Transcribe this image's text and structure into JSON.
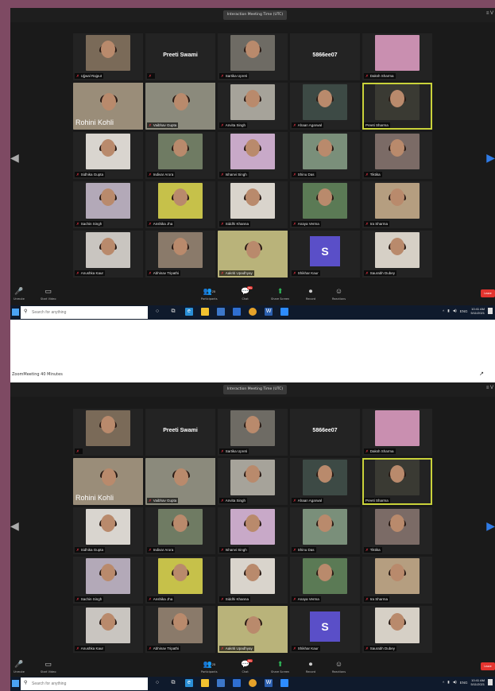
{
  "meeting_title": "Interaction Meeting Time (UTC)",
  "view_label": "≡ V",
  "gap_caption": "ZoomMeeting 40 Minutes",
  "gap_mark": "↗",
  "participants": {
    "r1c1": "Ujjwal Rajput",
    "r1c2": "Preeti Swami",
    "r1c3": "Sartika Upreti",
    "r1c4": "5866ee07",
    "r1c5": "Daksh Sharma",
    "r2c1": "Rohini Kohli",
    "r2c2": "Vaibhav Gupta",
    "r2c3": "Anvita Singh",
    "r2c4": "Ahaan Agarwal",
    "r2c5": "Preeti Sharma",
    "r3c1": "Sidhika Gupta",
    "r3c2": "Indivar Arora",
    "r3c3": "Ishanvi Singh",
    "r3c4": "Shinu Das",
    "r3c5": "Tiktika",
    "r4c1": "Sachin Singh",
    "r4c2": "Anshika Jha",
    "r4c3": "Siddhi Khanna",
    "r4c4": "Anaya Verma",
    "r4c5": "Ira Sharma",
    "r5c1": "Anushka Kaur",
    "r5c2": "Abhinav Tripathi",
    "r5c3": "Aakriti Upadhyay",
    "r5c4": "Shikhar Kaur",
    "r5c5": "Saurabh Dubey"
  },
  "avatar_letter": "S",
  "toolbar": {
    "unmute": "Unmute",
    "start_video": "Start Video",
    "participants": "Participants",
    "participants_count": "25",
    "chat": "Chat",
    "chat_badge": "99+",
    "share_screen": "Share Screen",
    "record": "Record",
    "reactions": "Reactions",
    "leave": "Leave"
  },
  "taskbar": {
    "search_placeholder": "Search for anything",
    "time": "10:41 AM",
    "date": "5/11/2021",
    "lang": "ENG"
  },
  "icons": {
    "mic": "mic-muted-icon",
    "video": "video-off-icon",
    "participants": "participants-icon",
    "chat": "chat-icon",
    "share": "share-screen-icon",
    "record": "record-icon",
    "reactions": "reactions-icon"
  },
  "tile_colors": [
    "#7a6a58",
    "#232323",
    "#6e6b64",
    "#232323",
    "#c98fb0",
    "#9a8d79",
    "#8b8a7c",
    "#a6a39a",
    "#3d4a45",
    "#3a3a33",
    "#d9d5cf",
    "#6f7b63",
    "#c8a9c8",
    "#7a8f7a",
    "#7b6b66",
    "#b3a9b8",
    "#c6c14a",
    "#d9d4cc",
    "#5b7a55",
    "#b59e80",
    "#c9c5c0",
    "#8a7a6a",
    "#b9b37a",
    "#5a4fc8",
    "#d6d0c6"
  ]
}
